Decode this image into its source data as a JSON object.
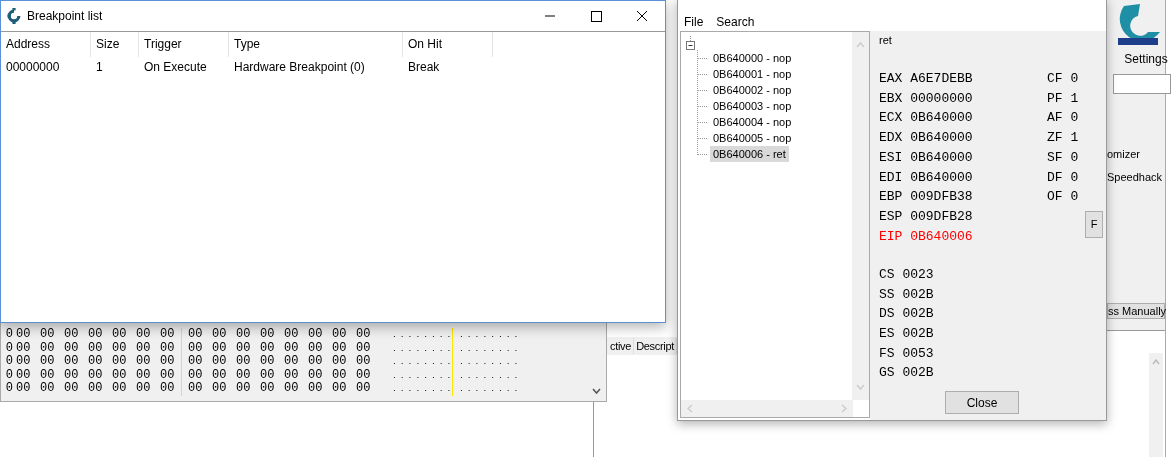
{
  "memory_view": {
    "rows": [
      {
        "bytes": [
          "0",
          "00",
          "00",
          "00",
          "00",
          "00",
          "00",
          "00",
          "00",
          "00",
          "00",
          "00",
          "00",
          "00",
          "00",
          "00"
        ],
        "ascii": [
          "........",
          "........"
        ]
      },
      {
        "bytes": [
          "0",
          "00",
          "00",
          "00",
          "00",
          "00",
          "00",
          "00",
          "00",
          "00",
          "00",
          "00",
          "00",
          "00",
          "00",
          "00"
        ],
        "ascii": [
          "........",
          "........"
        ]
      },
      {
        "bytes": [
          "0",
          "00",
          "00",
          "00",
          "00",
          "00",
          "00",
          "00",
          "00",
          "00",
          "00",
          "00",
          "00",
          "00",
          "00",
          "00"
        ],
        "ascii": [
          "........",
          "........"
        ]
      },
      {
        "bytes": [
          "0",
          "00",
          "00",
          "00",
          "00",
          "00",
          "00",
          "00",
          "00",
          "00",
          "00",
          "00",
          "00",
          "00",
          "00",
          "00"
        ],
        "ascii": [
          "........",
          "........"
        ]
      },
      {
        "bytes": [
          "0",
          "00",
          "00",
          "00",
          "00",
          "00",
          "00",
          "00",
          "00",
          "00",
          "00",
          "00",
          "00",
          "00",
          "00",
          "00"
        ],
        "ascii": [
          "........",
          "........"
        ]
      }
    ]
  },
  "main_window": {
    "settings_label": "Settings",
    "options": [
      "omizer",
      "Speedhack"
    ],
    "button": "ss Manually",
    "list_columns": [
      "ctive",
      "Descript"
    ]
  },
  "breakpoint_window": {
    "title": "Breakpoint list",
    "columns": [
      "Address",
      "Size",
      "Trigger",
      "Type",
      "On Hit"
    ],
    "rows": [
      [
        "00000000",
        "1",
        "On Execute",
        "Hardware Breakpoint (0)",
        "Break"
      ]
    ]
  },
  "tracer": {
    "menu": [
      "File",
      "Search"
    ],
    "tree": {
      "expanded": true,
      "children": [
        {
          "label": "0B640000 - nop",
          "selected": false
        },
        {
          "label": "0B640001 - nop",
          "selected": false
        },
        {
          "label": "0B640002 - nop",
          "selected": false
        },
        {
          "label": "0B640003 - nop",
          "selected": false
        },
        {
          "label": "0B640004 - nop",
          "selected": false
        },
        {
          "label": "0B640005 - nop",
          "selected": false
        },
        {
          "label": "0B640006 - ret",
          "selected": true
        }
      ]
    },
    "instruction": "ret",
    "registers": [
      {
        "name": "EAX",
        "value": "A6E7DEBB",
        "changed": false
      },
      {
        "name": "EBX",
        "value": "00000000",
        "changed": false
      },
      {
        "name": "ECX",
        "value": "0B640000",
        "changed": false
      },
      {
        "name": "EDX",
        "value": "0B640000",
        "changed": false
      },
      {
        "name": "ESI",
        "value": "0B640000",
        "changed": false
      },
      {
        "name": "EDI",
        "value": "0B640000",
        "changed": false
      },
      {
        "name": "EBP",
        "value": "009DFB38",
        "changed": false
      },
      {
        "name": "ESP",
        "value": "009DFB28",
        "changed": false
      },
      {
        "name": "EIP",
        "value": "0B640006",
        "changed": true
      }
    ],
    "flags": [
      {
        "name": "CF",
        "value": "0"
      },
      {
        "name": "PF",
        "value": "1"
      },
      {
        "name": "AF",
        "value": "0"
      },
      {
        "name": "ZF",
        "value": "1"
      },
      {
        "name": "SF",
        "value": "0"
      },
      {
        "name": "DF",
        "value": "0"
      },
      {
        "name": "OF",
        "value": "0"
      }
    ],
    "segments": [
      {
        "name": "CS",
        "value": "0023"
      },
      {
        "name": "SS",
        "value": "002B"
      },
      {
        "name": "DS",
        "value": "002B"
      },
      {
        "name": "ES",
        "value": "002B"
      },
      {
        "name": "FS",
        "value": "0053"
      },
      {
        "name": "GS",
        "value": "002B"
      }
    ],
    "f_button": "F",
    "close_button": "Close"
  }
}
